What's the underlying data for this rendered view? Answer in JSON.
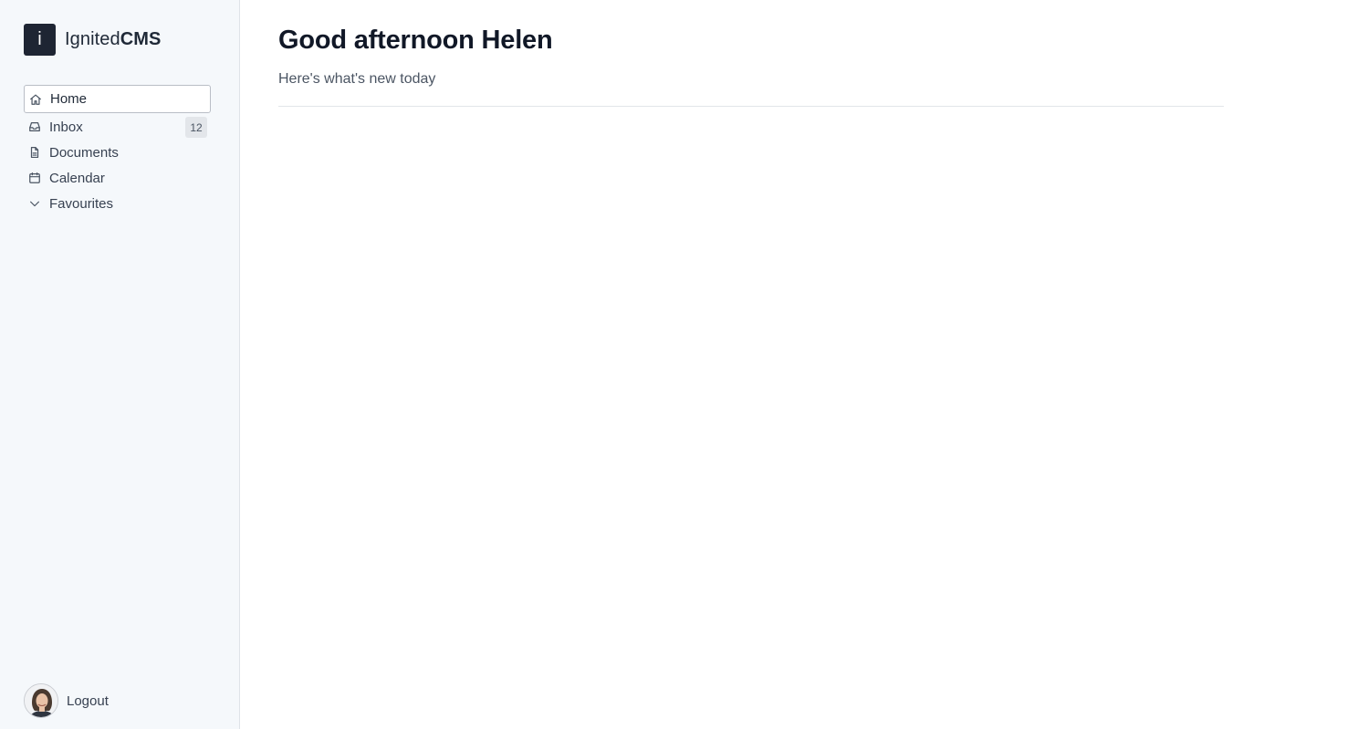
{
  "brand": {
    "logo_letter": "i",
    "name_regular": "Ignited",
    "name_bold": "CMS"
  },
  "nav": {
    "items": [
      {
        "label": "Home",
        "icon": "home-icon",
        "active": true
      },
      {
        "label": "Inbox",
        "icon": "inbox-icon",
        "badge": "12"
      },
      {
        "label": "Documents",
        "icon": "document-icon"
      },
      {
        "label": "Calendar",
        "icon": "calendar-icon"
      },
      {
        "label": "Favourites",
        "icon": "chevron-down-icon"
      }
    ]
  },
  "user": {
    "action_label": "Logout"
  },
  "main": {
    "greeting": "Good afternoon Helen",
    "subtitle": "Here's what's new today"
  },
  "colors": {
    "sidebar_bg": "#f5f8fb",
    "logo_bg": "#1e2533",
    "badge_bg": "#e3e6ea"
  }
}
